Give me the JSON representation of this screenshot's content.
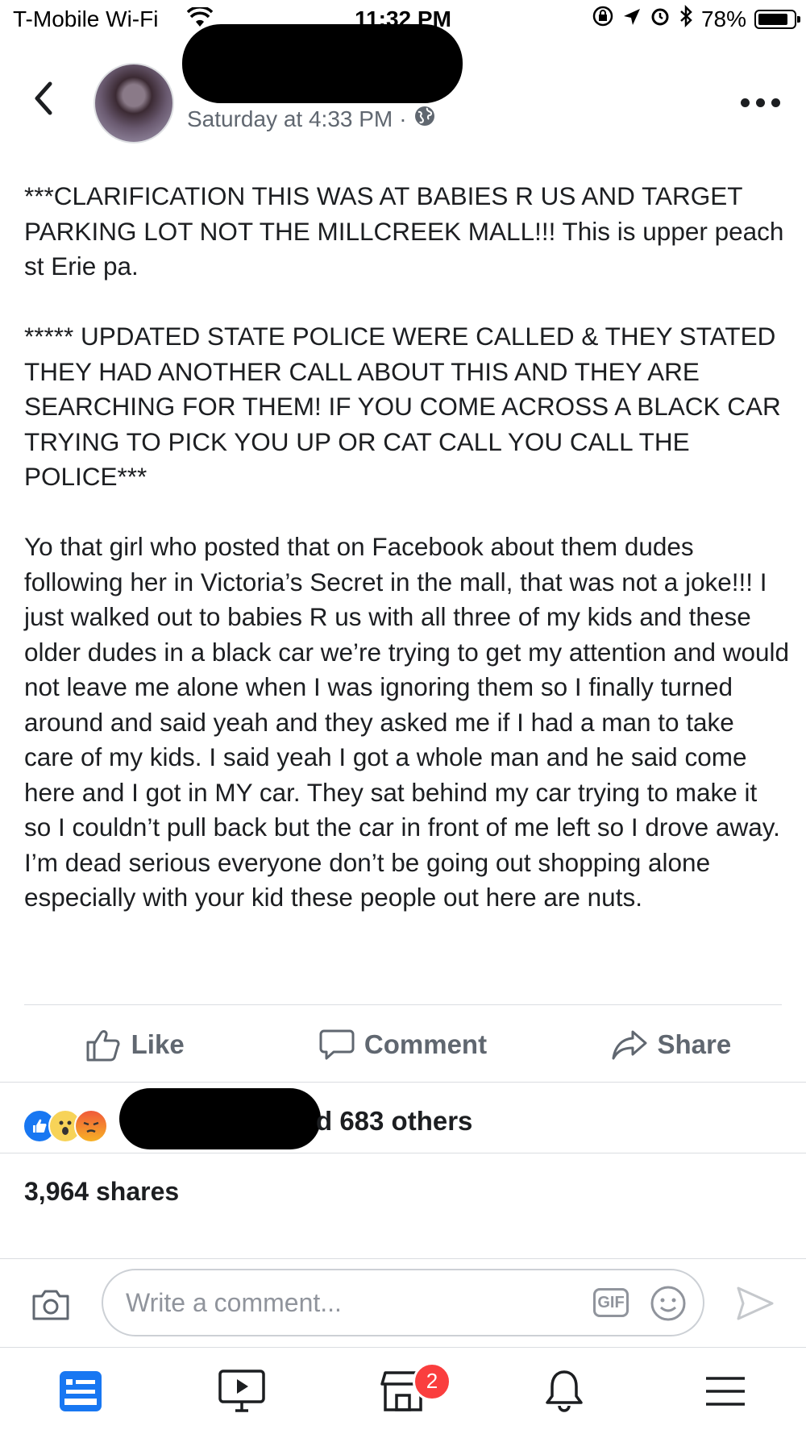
{
  "status_bar": {
    "carrier": "T-Mobile Wi-Fi",
    "time": "11:32 PM",
    "battery": "78%",
    "battery_level": 0.78
  },
  "post_header": {
    "timestamp": "Saturday at 4:33 PM",
    "separator": "·"
  },
  "post": {
    "paragraphs": [
      "***CLARIFICATION THIS WAS AT BABIES R US AND TARGET PARKING LOT NOT THE MILLCREEK MALL!!! This is upper peach st Erie pa.",
      "***** UPDATED STATE POLICE WERE CALLED & THEY STATED THEY HAD ANOTHER CALL ABOUT THIS AND THEY ARE SEARCHING FOR THEM! IF YOU COME ACROSS A BLACK CAR TRYING TO PICK YOU UP OR CAT CALL YOU CALL THE POLICE***",
      "Yo that girl who posted that on Facebook about them dudes following her in Victoria’s Secret in the mall, that was not a joke!!! I just walked out to babies R us with all three of my kids and these older dudes in a black car we’re trying to get my attention and would not leave me alone when I was ignoring them so I finally turned around and said yeah and they asked me if I had a man to take care of my kids. I said yeah I got a whole man and he said come here and I got in MY car. They sat behind my car trying to make it so I couldn’t pull back but the car in front of me left so I drove away. I’m dead serious everyone don’t be going out shopping alone especially with your kid these people out here are nuts."
    ]
  },
  "actions": {
    "like": "Like",
    "comment": "Comment",
    "share": "Share"
  },
  "reactions": {
    "others_text": "d 683 others",
    "icons": [
      "like-icon",
      "wow-icon",
      "angry-icon"
    ]
  },
  "shares_text": "3,964 shares",
  "composer": {
    "placeholder": "Write a comment...",
    "gif_label": "GIF"
  },
  "tabbar": {
    "marketplace_badge": "2"
  },
  "colors": {
    "accent": "#1877f2",
    "muted": "#606770",
    "badge": "#fa3e3e"
  }
}
